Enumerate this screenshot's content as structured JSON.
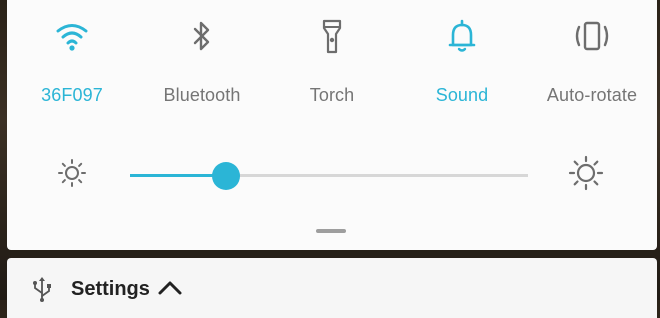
{
  "quick_settings": {
    "tiles": [
      {
        "label": "36F097",
        "icon": "wifi-icon",
        "active": true
      },
      {
        "label": "Bluetooth",
        "icon": "bluetooth-icon",
        "active": false
      },
      {
        "label": "Torch",
        "icon": "flashlight-icon",
        "active": false
      },
      {
        "label": "Sound",
        "icon": "bell-icon",
        "active": true
      },
      {
        "label": "Auto-rotate",
        "icon": "rotate-icon",
        "active": false
      }
    ],
    "brightness": {
      "level": 0.24
    },
    "colors": {
      "accent": "#2bb5d6",
      "inactive": "#757575"
    }
  },
  "notification": {
    "title": "Settings",
    "icon": "usb-icon",
    "expand_icon": "chevron-up-icon"
  }
}
